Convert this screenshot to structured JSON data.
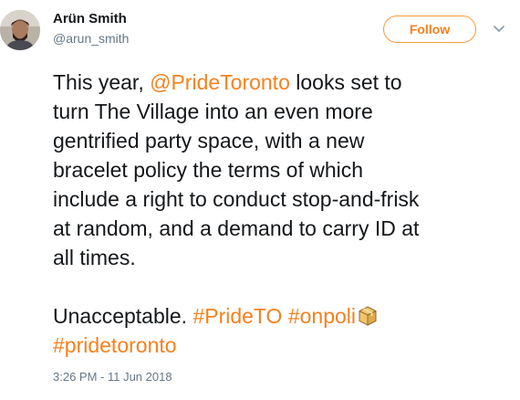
{
  "user": {
    "display_name": "Arün Smith",
    "username": "@arun_smith"
  },
  "follow_button": {
    "label": "Follow"
  },
  "icons": {
    "menu": "chevron-down-icon",
    "emoji": "package-emoji-icon",
    "avatar": "avatar"
  },
  "tweet": {
    "lines": [
      [
        "This year, ",
        "@PrideToronto",
        " looks set to"
      ],
      [
        "turn The Village into an even more"
      ],
      [
        "gentrified party space, with a new"
      ],
      [
        "bracelet policy the terms of which"
      ],
      [
        "include a right to conduct stop-and-frisk"
      ],
      [
        "at random, and a demand to carry ID at"
      ],
      [
        "all times."
      ]
    ],
    "line2_prefix": "Unacceptable. ",
    "hashtag_pride_to": "#PrideTO",
    "hashtag_onpoli": "#onpoli",
    "hashtag_pridetoronto": "#pridetoronto",
    "mention": "@PrideToronto",
    "para1_l1_before": "This year, ",
    "para1_l1_after": " looks set to",
    "para1_l2": "turn The Village into an even more",
    "para1_l3": "gentrified party space, with a new",
    "para1_l4": "bracelet policy the terms of which",
    "para1_l5": "include a right to conduct stop-and-frisk",
    "para1_l6": "at random, and a demand to carry ID at",
    "para1_l7": "all times."
  },
  "timestamp": "3:26 PM - 11 Jun 2018",
  "colors": {
    "accent": "#f5811f",
    "text": "#14171a",
    "secondary": "#657786"
  }
}
